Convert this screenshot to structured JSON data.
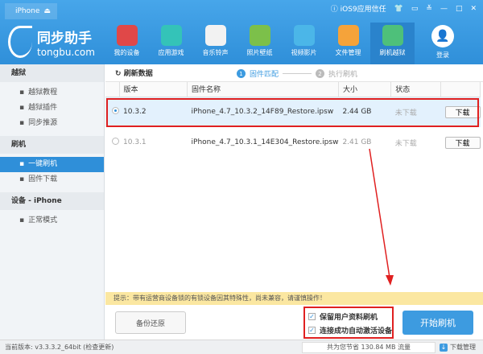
{
  "titlebar": {
    "device": "iPhone",
    "ios9_trust": "iOS9应用信任"
  },
  "logo": {
    "name": "同步助手",
    "domain": "tongbu.com"
  },
  "nav": [
    {
      "label": "我的设备",
      "color": "#e04848"
    },
    {
      "label": "应用游戏",
      "color": "#34c3b8"
    },
    {
      "label": "音乐铃声",
      "color": "#f2f2f2"
    },
    {
      "label": "照片壁纸",
      "color": "#7cc04a"
    },
    {
      "label": "视频影片",
      "color": "#4bb6e8"
    },
    {
      "label": "文件管理",
      "color": "#f5a33a"
    },
    {
      "label": "刷机越狱",
      "color": "#4ec07a"
    }
  ],
  "login": "登录",
  "sidebar": {
    "sections": [
      {
        "title": "越狱",
        "items": [
          "越狱教程",
          "越狱插件",
          "同步推源"
        ]
      },
      {
        "title": "刷机",
        "items": [
          "一键刷机",
          "固件下载"
        ]
      },
      {
        "title": "设备 - iPhone",
        "items": [
          "正常模式"
        ]
      }
    ]
  },
  "toolbar": {
    "refresh": "刷新数据",
    "step1": "固件匹配",
    "step2": "执行刷机"
  },
  "table": {
    "headers": [
      "版本",
      "固件名称",
      "大小",
      "状态"
    ],
    "rows": [
      {
        "version": "10.3.2",
        "name": "iPhone_4.7_10.3.2_14F89_Restore.ipsw",
        "size": "2.44 GB",
        "status": "未下载",
        "action": "下载"
      },
      {
        "version": "10.3.1",
        "name": "iPhone_4.7_10.3.1_14E304_Restore.ipsw",
        "size": "2.41 GB",
        "status": "未下载",
        "action": "下载"
      }
    ]
  },
  "tip": "提示：带有运营商设备锁的有锁设备因其特殊性，尚未兼容，请谨慎操作！",
  "backup": "备份还原",
  "options": [
    "保留用户资料刷机",
    "连接成功自动激活设备"
  ],
  "start": "开始刷机",
  "status": {
    "version": "当前版本: v3.3.3.2_64bit",
    "check": "(检查更新)",
    "saved": "共为您节省  130.84 MB 流量",
    "download_mgr": "下载管理"
  }
}
